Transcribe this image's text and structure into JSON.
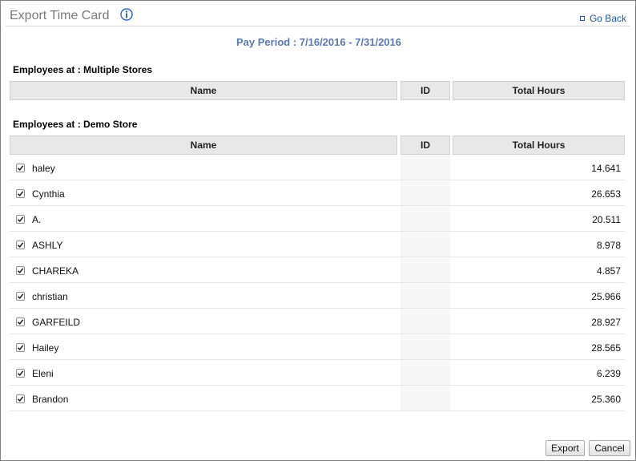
{
  "header": {
    "title": "Export Time Card",
    "go_back": "Go Back"
  },
  "pay_period": "Pay Period : 7/16/2016 - 7/31/2016",
  "columns": {
    "name": "Name",
    "id": "ID",
    "total_hours": "Total Hours"
  },
  "groups": [
    {
      "label": "Employees at : Multiple Stores",
      "rows": []
    },
    {
      "label": "Employees at : Demo Store",
      "rows": [
        {
          "name": "haley",
          "id": "",
          "hours": "14.641",
          "checked": true
        },
        {
          "name": "Cynthia",
          "id": "",
          "hours": "26.653",
          "checked": true
        },
        {
          "name": "A.",
          "id": "",
          "hours": "20.511",
          "checked": true
        },
        {
          "name": "ASHLY",
          "id": "",
          "hours": "8.978",
          "checked": true
        },
        {
          "name": "CHAREKA",
          "id": "",
          "hours": "4.857",
          "checked": true
        },
        {
          "name": "christian",
          "id": "",
          "hours": "25.966",
          "checked": true
        },
        {
          "name": "GARFEILD",
          "id": "",
          "hours": "28.927",
          "checked": true
        },
        {
          "name": "Hailey",
          "id": "",
          "hours": "28.565",
          "checked": true
        },
        {
          "name": "Eleni",
          "id": "",
          "hours": "6.239",
          "checked": true
        },
        {
          "name": "Brandon",
          "id": "",
          "hours": "25.360",
          "checked": true
        }
      ]
    }
  ],
  "buttons": {
    "export": "Export",
    "cancel": "Cancel"
  },
  "colors": {
    "title": "#7a7a7a",
    "link": "#1f56a8",
    "pay_period": "#5b78b2",
    "header_bg": "#e8e8e8"
  }
}
